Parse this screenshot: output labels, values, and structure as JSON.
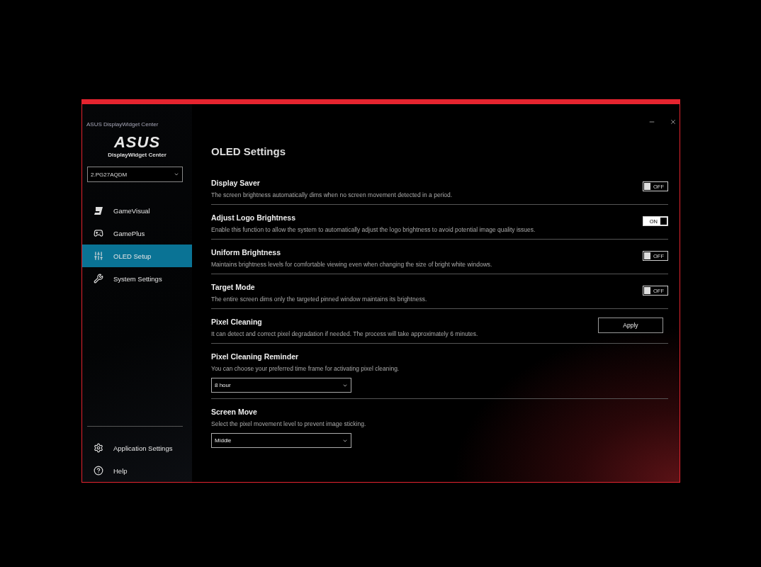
{
  "window": {
    "title": "ASUS DisplayWidget Center"
  },
  "sidebar": {
    "logo": "ASUS",
    "subtitle": "DisplayWidget Center",
    "monitor_select": {
      "value": "2.PG27AQDM"
    },
    "items": [
      {
        "label": "GameVisual",
        "kind": "gamevisual",
        "selected": false
      },
      {
        "label": "GamePlus",
        "kind": "gamepad",
        "selected": false
      },
      {
        "label": "OLED Setup",
        "kind": "sliders",
        "selected": true
      },
      {
        "label": "System Settings",
        "kind": "tools",
        "selected": false
      }
    ],
    "footer_items": [
      {
        "label": "Application Settings",
        "kind": "gear"
      },
      {
        "label": "Help",
        "kind": "help"
      }
    ]
  },
  "content": {
    "title": "OLED Settings",
    "settings": [
      {
        "kind": "toggle",
        "title": "Display Saver",
        "description": "The screen brightness automatically dims when no screen movement detected in a period.",
        "on": false,
        "state_label": "OFF"
      },
      {
        "kind": "toggle",
        "title": "Adjust Logo Brightness",
        "description": "Enable this function to allow the system to automatically adjust the logo brightness to avoid potential image quality issues.",
        "on": true,
        "state_label": "ON"
      },
      {
        "kind": "toggle",
        "title": "Uniform Brightness",
        "description": "Maintains brightness levels for comfortable viewing even when changing the size of bright white windows.",
        "on": false,
        "state_label": "OFF"
      },
      {
        "kind": "toggle",
        "title": "Target Mode",
        "description": "The entire screen dims only the targeted pinned window maintains its brightness.",
        "on": false,
        "state_label": "OFF"
      },
      {
        "kind": "button",
        "title": "Pixel Cleaning",
        "description": "It can detect and correct pixel degradation if needed. The process will take approximately 6 minutes.",
        "button": "Apply"
      },
      {
        "kind": "select",
        "title": "Pixel Cleaning Reminder",
        "description": "You can choose your preferred time frame for activating pixel cleaning.",
        "value": "8 hour"
      },
      {
        "kind": "select",
        "title": "Screen Move",
        "description": "Select the pixel movement level to prevent image sticking.",
        "value": "Middle"
      }
    ]
  }
}
